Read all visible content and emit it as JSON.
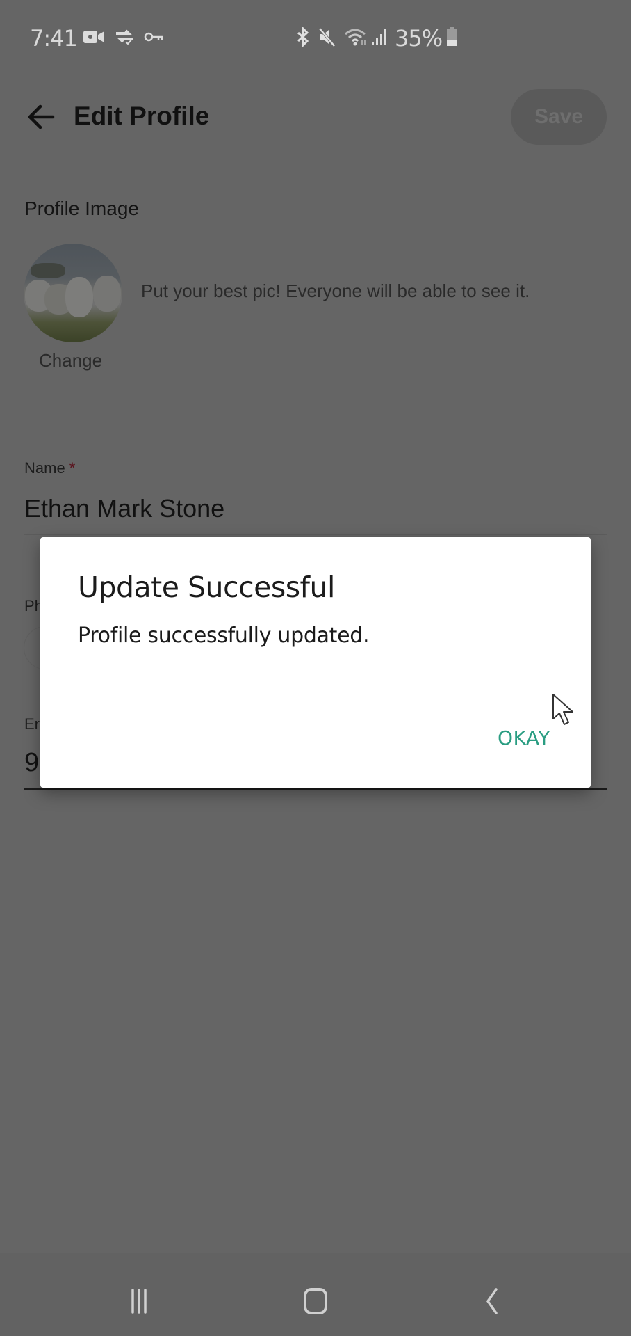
{
  "status_bar": {
    "time": "7:41",
    "left_icons": [
      "video-camera-icon",
      "sync-check-icon",
      "vpn-key-icon"
    ],
    "right_icons": [
      "bluetooth-icon",
      "mute-icon",
      "wifi-icon",
      "signal-icon"
    ],
    "battery_percent": "35%",
    "battery_level": 0.35
  },
  "header": {
    "title": "Edit Profile",
    "save_label": "Save"
  },
  "profile_image": {
    "section_label": "Profile Image",
    "hint": "Put your best pic! Everyone will be able to see it.",
    "change_label": "Change"
  },
  "form": {
    "name": {
      "label": "Name",
      "required_mark": "*",
      "value": "Ethan Mark Stone"
    },
    "phone": {
      "label_visible": "Ph"
    },
    "email": {
      "label_visible": "Er",
      "value_visible": "9",
      "trailing_visible": ")"
    }
  },
  "dialog": {
    "title": "Update Successful",
    "message": "Profile successfully updated.",
    "ok_label": "OKAY",
    "accent_color": "#2a9d82"
  },
  "nav_bar": {
    "buttons": [
      "recent-apps",
      "home",
      "back"
    ]
  }
}
